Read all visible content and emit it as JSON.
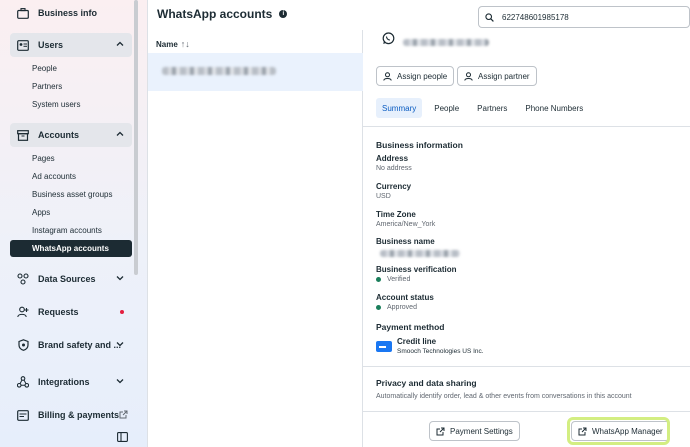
{
  "sidebar": {
    "business_info": "Business info",
    "users": {
      "label": "Users",
      "items": [
        "People",
        "Partners",
        "System users"
      ]
    },
    "accounts": {
      "label": "Accounts",
      "items": [
        "Pages",
        "Ad accounts",
        "Business asset groups",
        "Apps",
        "Instagram accounts",
        "WhatsApp accounts"
      ],
      "active": "WhatsApp accounts"
    },
    "data_sources": "Data Sources",
    "requests": "Requests",
    "brand_safety": "Brand safety and ...",
    "integrations": "Integrations",
    "billing": "Billing & payments"
  },
  "header": {
    "title": "WhatsApp accounts",
    "info_icon": "i",
    "search_value": "622748601985178"
  },
  "list": {
    "column_header": "Name",
    "sort_icon": "↑↓"
  },
  "detail": {
    "assign_people": "Assign people",
    "assign_partner": "Assign partner",
    "tabs": [
      "Summary",
      "People",
      "Partners",
      "Phone Numbers"
    ],
    "active_tab": "Summary",
    "business_information": "Business information",
    "address_label": "Address",
    "address_value": "No address",
    "currency_label": "Currency",
    "currency_value": "USD",
    "timezone_label": "Time Zone",
    "timezone_value": "America/New_York",
    "business_name_label": "Business name",
    "verification_label": "Business verification",
    "verification_value": "Verified",
    "account_status_label": "Account status",
    "account_status_value": "Approved",
    "payment_method_label": "Payment method",
    "credit_line": "Credit line",
    "credit_provider": "Smooch Technologies US Inc.",
    "privacy_title": "Privacy and data sharing",
    "privacy_desc": "Automatically identify order, lead & other events from conversations in this account",
    "payment_settings": "Payment Settings",
    "whatsapp_manager": "WhatsApp Manager"
  },
  "colors": {
    "active_nav": "#1c2b33",
    "active_tab": "#0a5cc2",
    "status_green": "#1a7e5b",
    "highlight": "#d3ee82",
    "notification_dot": "#e41e3f"
  }
}
